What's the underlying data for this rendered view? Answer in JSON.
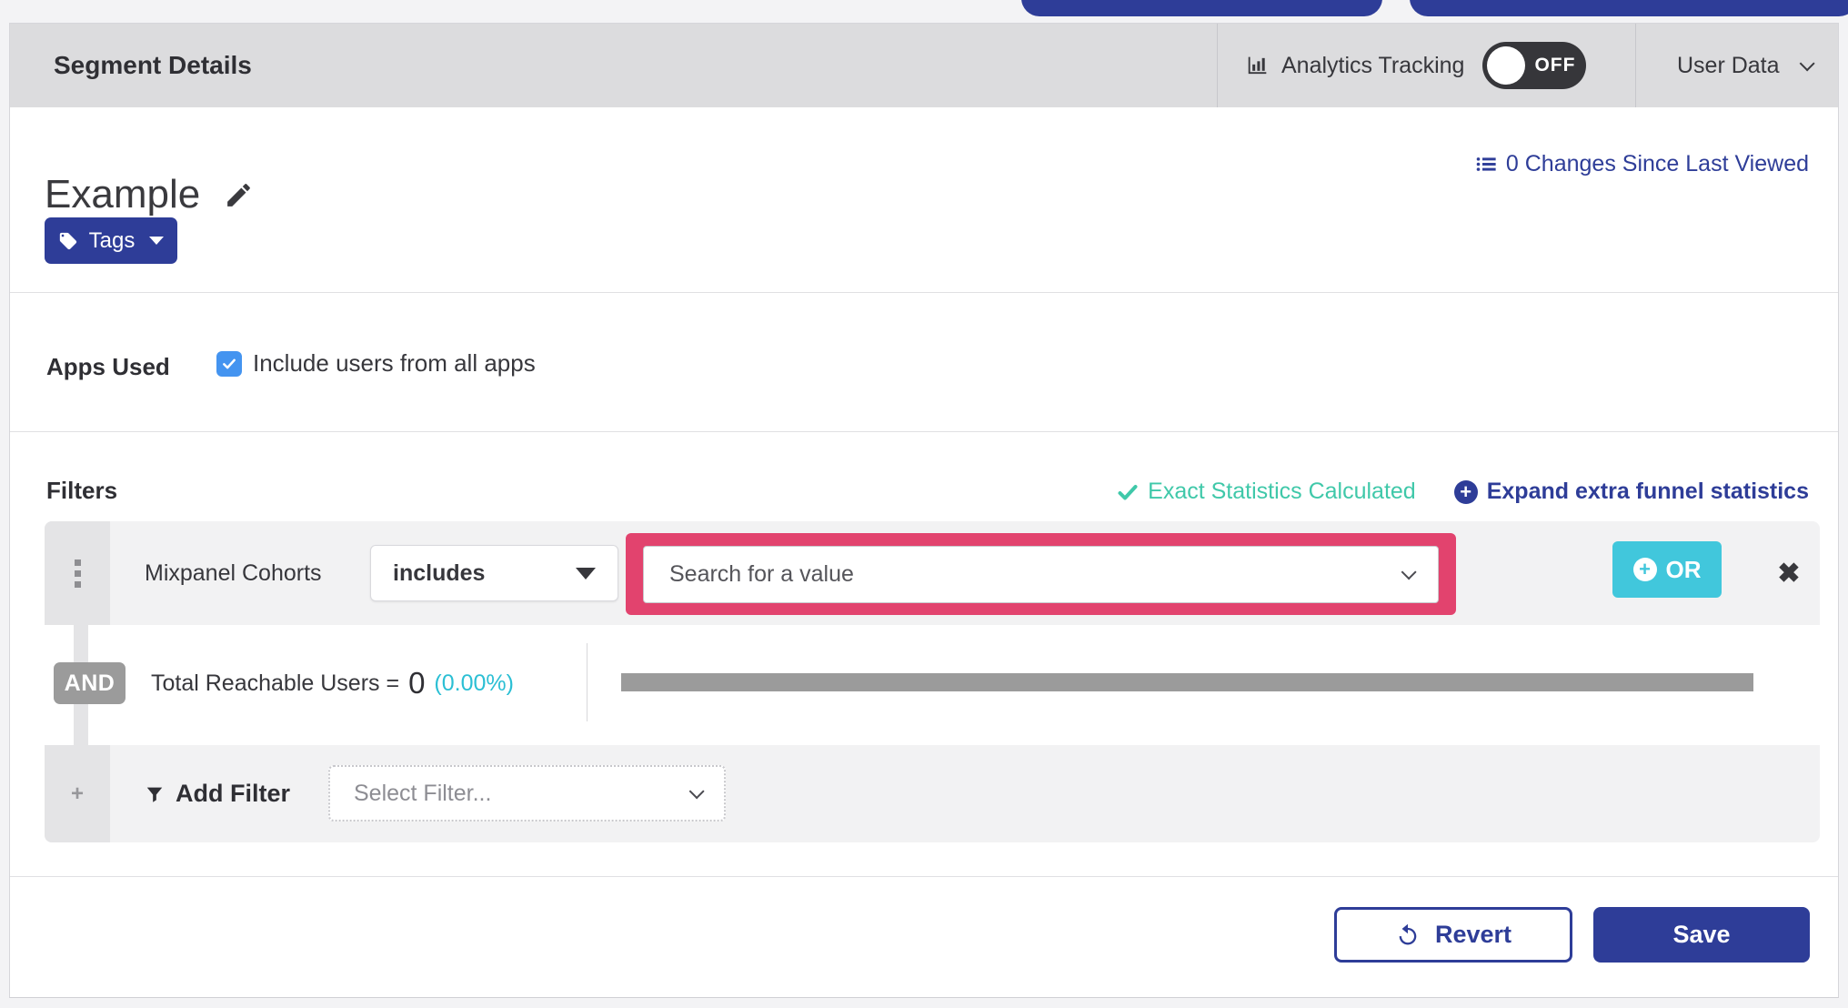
{
  "header": {
    "title": "Segment Details",
    "analytics_label": "Analytics Tracking",
    "toggle_state": "OFF",
    "user_data_label": "User Data"
  },
  "segment": {
    "name": "Example",
    "tags_label": "Tags",
    "changes_link": "0 Changes Since Last Viewed"
  },
  "apps_used": {
    "label": "Apps Used",
    "checkbox_label": "Include users from all apps",
    "checked": true
  },
  "filters": {
    "label": "Filters",
    "status_text": "Exact Statistics Calculated",
    "expand_link": "Expand extra funnel statistics",
    "row1": {
      "field": "Mixpanel Cohorts",
      "operator": "includes",
      "value_placeholder": "Search for a value",
      "or_label": "OR",
      "plus_glyph": "+"
    },
    "and_label": "AND",
    "total_label": "Total Reachable Users =",
    "total_value": "0",
    "total_pct": "(0.00%)",
    "add_filter_label": "Add Filter",
    "add_plus_glyph": "+",
    "select_filter_placeholder": "Select Filter...",
    "expand_plus_glyph": "+"
  },
  "footer": {
    "revert_label": "Revert",
    "save_label": "Save"
  },
  "colors": {
    "brand_blue": "#2e3d98",
    "teal_or": "#41c7dc",
    "green_status": "#3fc8a9",
    "cyan_pct": "#2bbfd4",
    "pink_highlight": "#e2436e",
    "checkbox_blue": "#4494f0",
    "badge_gray": "#9b9b9b",
    "header_gray": "#dcdcde"
  }
}
